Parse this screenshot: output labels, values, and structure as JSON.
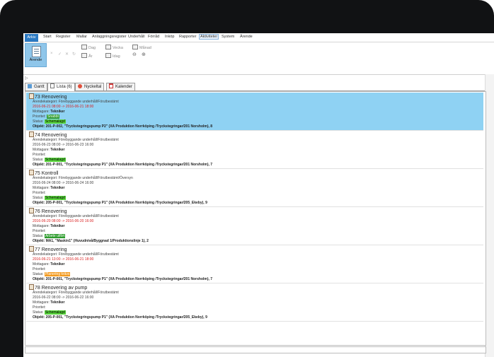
{
  "menu": {
    "items": [
      {
        "label": "Arkiv"
      },
      {
        "label": "Start"
      },
      {
        "label": "Register"
      },
      {
        "label": "Mallar"
      },
      {
        "label": "Anläggningsregister"
      },
      {
        "label": "Underhåll"
      },
      {
        "label": "Förråd"
      },
      {
        "label": "Inköp"
      },
      {
        "label": "Rapporter"
      },
      {
        "label": "Aktiviteter"
      },
      {
        "label": "System"
      },
      {
        "label": "Ärende"
      }
    ]
  },
  "ribbon": {
    "arende_label": "Ärende",
    "dag": "Dag",
    "ar": "År",
    "vecka": "Vecka",
    "idag": "Idag",
    "manad": "Månad"
  },
  "tabs": [
    {
      "label": "Gantt"
    },
    {
      "label": "Lista (6)"
    },
    {
      "label": "Nyckeltal"
    },
    {
      "label": "Kalender"
    }
  ],
  "cards": [
    {
      "title": "73 Renovering",
      "kategori": "Ärendekategori: Förebyggande underhåll/Förutbestämt",
      "datum": "2016-06-21 08:00 -> 2016-06-21 18:00",
      "mottagare_label": "Mottagare:",
      "mottagare_value": "Tekniker",
      "prioritet_label": "Prioritet:",
      "prioritet_value": "Snabbt",
      "status_label": "Status:",
      "status_value": "Schemalagd",
      "objekt": "Objekt: 201-P-002, \"Tryckstegringspump P2\" (XA Produktion Norrköping /Tryckstegringar/201 Norsholm), 8"
    },
    {
      "title": "74 Renovering",
      "kategori": "Ärendekategori: Förebyggande underhåll/Förutbestämt",
      "datum": "2016-06-23 08:00 -> 2016-06-23 16:00",
      "mottagare_label": "Mottagare:",
      "mottagare_value": "Tekniker",
      "prioritet_label": "Prioritet:",
      "prioritet_value": "",
      "status_label": "Status:",
      "status_value": "Schemalagd",
      "objekt": "Objekt: 201-P-001, \"Tryckstegringspump P1\" (XA Produktion Norrköping /Tryckstegringar/201 Norsholm), 7"
    },
    {
      "title": "75 Kontroll",
      "kategori": "Ärendekategori: Förebyggande underhåll/Förutbestämt/Översyn",
      "datum": "2016-06-24 08:00 -> 2016-06-24 16:00",
      "mottagare_label": "Mottagare:",
      "mottagare_value": "Tekniker",
      "prioritet_label": "Prioritet:",
      "prioritet_value": "",
      "status_label": "Status:",
      "status_value": "Schemalagd",
      "objekt": "Objekt: 205-P-001, \"Tryckstegringspump P1\" (XA Produktion Norrköping /Tryckstegringar/205_Ekeby), 9"
    },
    {
      "title": "76 Renovering",
      "kategori": "Ärendekategori: Förebyggande underhåll/Förutbestämt",
      "datum": "2016-06-20 08:00 -> 2016-06-20 16:00",
      "mottagare_label": "Mottagare:",
      "mottagare_value": "Tekniker",
      "prioritet_label": "Prioritet:",
      "prioritet_value": "",
      "status_label": "Status:",
      "status_value": "Arbete utfört",
      "objekt": "Objekt: MA1, \"Maskin1\" (Huvudnivå/Byggnad 1/Produktionslinje 1), 2"
    },
    {
      "title": "77 Renovering",
      "kategori": "Ärendekategori: Förebyggande underhåll/Förutbestämt",
      "datum": "2016-06-21 13:00 -> 2016-06-21 18:00",
      "mottagare_label": "Mottagare:",
      "mottagare_value": "Tekniker",
      "prioritet_label": "Prioritet:",
      "prioritet_value": "",
      "status_label": "Status:",
      "status_value": "Planering krävs",
      "objekt": "Objekt: 201-P-001, \"Tryckstegringspump P1\" (XA Produktion Norrköping /Tryckstegringar/201 Norsholm), 7"
    },
    {
      "title": "78 Renovering av pump",
      "kategori": "Ärendekategori: Förebyggande underhåll/Förutbestämt",
      "datum": "2016-06-22 08:00 -> 2016-06-22 16:00",
      "mottagare_label": "Mottagare:",
      "mottagare_value": "Tekniker",
      "prioritet_label": "Prioritet:",
      "prioritet_value": "",
      "status_label": "Status:",
      "status_value": "Schemalagd",
      "objekt": "Objekt: 205-P-001, \"Tryckstegringspump P1\" (XA Produktion Norrköping /Tryckstegringar/205_Ekeby), 9"
    }
  ]
}
